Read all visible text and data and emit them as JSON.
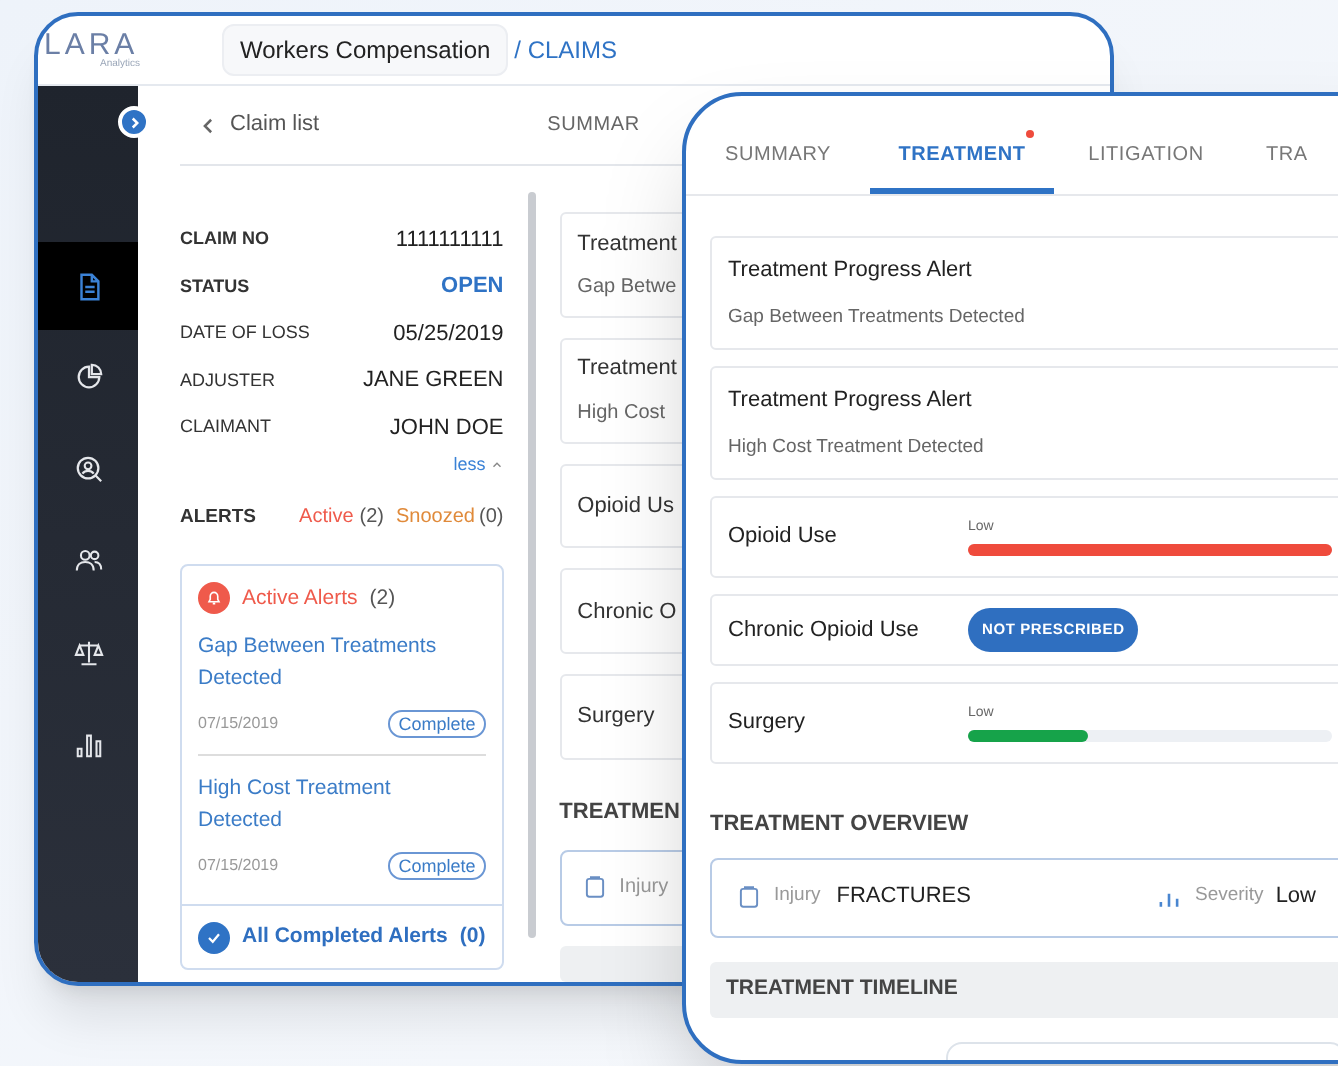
{
  "back_window": {
    "logo": {
      "name": "LARA",
      "tagline": "Analytics"
    },
    "breadcrumb": {
      "section": "Workers Compensation",
      "page": "/ CLAIMS"
    },
    "sidebar_items": [
      {
        "kind": "document",
        "selected": true
      },
      {
        "kind": "pie",
        "selected": false
      },
      {
        "kind": "search-user",
        "selected": false
      },
      {
        "kind": "users",
        "selected": false
      },
      {
        "kind": "scales",
        "selected": false
      },
      {
        "kind": "bars",
        "selected": false
      }
    ],
    "back_link": "Claim list",
    "tab_partial": "SUMMAR",
    "claim_fields": [
      {
        "label": "CLAIM NO",
        "value": "1111111111",
        "kind": "plain"
      },
      {
        "label": "STATUS",
        "value": "OPEN",
        "kind": "status"
      },
      {
        "label": "DATE OF LOSS",
        "value": "05/25/2019",
        "kind": "plain"
      },
      {
        "label": "ADJUSTER",
        "value": "JANE GREEN",
        "kind": "plain"
      },
      {
        "label": "CLAIMANT",
        "value": "JOHN DOE",
        "kind": "plain"
      }
    ],
    "less_link": "less",
    "alerts": {
      "label": "ALERTS",
      "active": "Active",
      "active_count": "(2)",
      "snoozed": "Snoozed",
      "snoozed_count": "(0)"
    },
    "alerts_card": {
      "title": "Active Alerts",
      "count": "(2)",
      "items": [
        {
          "title": "Gap Between Treatments Detected",
          "date": "07/15/2019",
          "action": "Complete"
        },
        {
          "title": "High Cost Treatment Detected",
          "date": "07/15/2019",
          "action": "Complete"
        }
      ],
      "footer": "All Completed Alerts",
      "footer_count": "(0)"
    },
    "cards": [
      {
        "title": "Treatment",
        "subtitle": "Gap Betwe"
      },
      {
        "title": "Treatment",
        "subtitle": "High Cost"
      },
      {
        "title": "Opioid Us"
      },
      {
        "title": "Chronic O"
      },
      {
        "title": "Surgery"
      }
    ],
    "section_heading": "TREATMEN",
    "injury_label": "Injury"
  },
  "front_window": {
    "tabs": [
      {
        "label": "SUMMARY",
        "selected": false,
        "badge": false
      },
      {
        "label": "TREATMENT",
        "selected": true,
        "badge": true
      },
      {
        "label": "LITIGATION",
        "selected": false,
        "badge": false
      },
      {
        "label": "TRA",
        "selected": false,
        "badge": false
      }
    ],
    "alert_cards": [
      {
        "title": "Treatment Progress Alert",
        "detail": "Gap Between Treatments Detected"
      },
      {
        "title": "Treatment Progress Alert",
        "detail": "High Cost Treatment Detected"
      }
    ],
    "risk_rows": [
      {
        "kind": "meter",
        "label": "Opioid Use",
        "scale": "Low",
        "level": 1,
        "color": "#ef4b3c"
      },
      {
        "kind": "pill",
        "label": "Chronic Opioid Use",
        "value": "NOT PRESCRIBED"
      },
      {
        "kind": "meter",
        "label": "Surgery",
        "scale": "Low",
        "level": 0.33,
        "color": "#16a34a"
      }
    ],
    "overview": {
      "heading": "TREATMENT OVERVIEW",
      "injury_label": "Injury",
      "injury_value": "FRACTURES",
      "severity_label": "Severity",
      "severity_value": "Low"
    },
    "timeline_heading": "TREATMENT TIMELINE"
  }
}
